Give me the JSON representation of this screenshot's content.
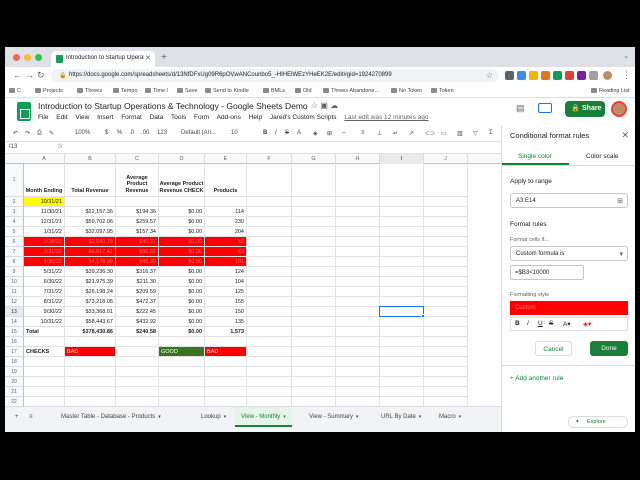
{
  "browser": {
    "tab_title": "Introduction to Startup Operat",
    "url": "https://docs.google.com/spreadsheets/d/13NfDFxUg09R6pOVwANCounbo5_-HIHElWEzYHeEK2E/edit#gid=1924270899",
    "bookmarks": [
      "C",
      "Projects",
      "Threes",
      "Tempo",
      "Time l",
      "Save",
      "Send to Kindle",
      "BMLs",
      "Old",
      "Threes Abandone...",
      "No Token",
      "Token"
    ],
    "reading_list": "Reading List"
  },
  "sheet": {
    "title": "Introduction to Startup Operations & Technology - Google Sheets Demo",
    "menu": [
      "File",
      "Edit",
      "View",
      "Insert",
      "Format",
      "Data",
      "Tools",
      "Form",
      "Add-ons",
      "Help",
      "Jared's Custom Scripts"
    ],
    "last_edit": "Last edit was 12 minutes ago",
    "share_label": "Share"
  },
  "toolbar": {
    "zoom": "100%",
    "currency": "$",
    "percent": "%",
    "dec1": ".0",
    "dec2": ".00",
    "format": "123",
    "font": "Default (Ari...",
    "font_size": "10"
  },
  "formula_bar": {
    "name_box": "I13",
    "fx": "fx"
  },
  "columns": [
    "A",
    "B",
    "C",
    "D",
    "E",
    "F",
    "G",
    "H",
    "I",
    "J"
  ],
  "rows": [
    "1",
    "2",
    "3",
    "4",
    "5",
    "6",
    "7",
    "8",
    "9",
    "10",
    "11",
    "12",
    "13",
    "14",
    "15",
    "16",
    "17",
    "18",
    "19",
    "20",
    "21",
    "22"
  ],
  "table": {
    "headers": [
      "Month Ending",
      "Total Revenue",
      "Average Product Revenue",
      "Average Product Revenue CHECK",
      "Products"
    ],
    "data": [
      [
        "10/31/21",
        "",
        "",
        "",
        ""
      ],
      [
        "11/30/21",
        "$22,157.36",
        "$194.36",
        "$0.00",
        "114"
      ],
      [
        "12/31/21",
        "$59,702.06",
        "$259.57",
        "$0.00",
        "230"
      ],
      [
        "1/31/22",
        "$32,097.95",
        "$157.34",
        "$0.00",
        "204"
      ],
      [
        "2/28/22",
        "$2,543.75",
        "$40.37",
        "$0.00",
        "58"
      ],
      [
        "3/31/22",
        "$5,017.41",
        "$86.51",
        "$0.00",
        "63"
      ],
      [
        "4/30/22",
        "$4,178.98",
        "$41.39",
        "$0.00",
        "101"
      ],
      [
        "5/31/22",
        "$39,236.30",
        "$316.37",
        "$0.00",
        "124"
      ],
      [
        "6/30/22",
        "$21,975.39",
        "$211.30",
        "$0.00",
        "104"
      ],
      [
        "7/31/22",
        "$26,198.24",
        "$209.59",
        "$0.00",
        "125"
      ],
      [
        "8/31/22",
        "$73,218.05",
        "$472.37",
        "$0.00",
        "155"
      ],
      [
        "9/30/22",
        "$33,368.01",
        "$222.45",
        "$0.00",
        "150"
      ],
      [
        "10/31/22",
        "$58,443.67",
        "$432.92",
        "$0.00",
        "135"
      ]
    ],
    "total": [
      "Total",
      "$378,430.86",
      "$240.58",
      "$0.00",
      "1,573"
    ],
    "checks_label": "CHECKS",
    "checks": [
      "BAD",
      "GOOD",
      "BAD"
    ]
  },
  "sheet_tabs": [
    {
      "label": "Master Table - Database - Products",
      "active": false
    },
    {
      "label": "Lookup",
      "active": false
    },
    {
      "label": "View - Monthly",
      "active": true
    },
    {
      "label": "View - Summary",
      "active": false
    },
    {
      "label": "URL By Date",
      "active": false
    },
    {
      "label": "Macro",
      "active": false
    }
  ],
  "panel": {
    "title": "Conditional format rules",
    "tab_single": "Single color",
    "tab_scale": "Color scale",
    "apply_label": "Apply to range",
    "range": "A3:E14",
    "rules_label": "Format rules",
    "format_if": "Format cells if...",
    "condition": "Custom formula is",
    "formula": "=$B3<10000",
    "style_label": "Formatting style",
    "style_preview": "Custom",
    "cancel": "Cancel",
    "done": "Done",
    "add_rule": "Add another rule",
    "explore": "Explore"
  },
  "colors": {
    "green": "#188038",
    "red": "#ff0000",
    "yellow": "#ffff00",
    "blue": "#1a73e8"
  }
}
